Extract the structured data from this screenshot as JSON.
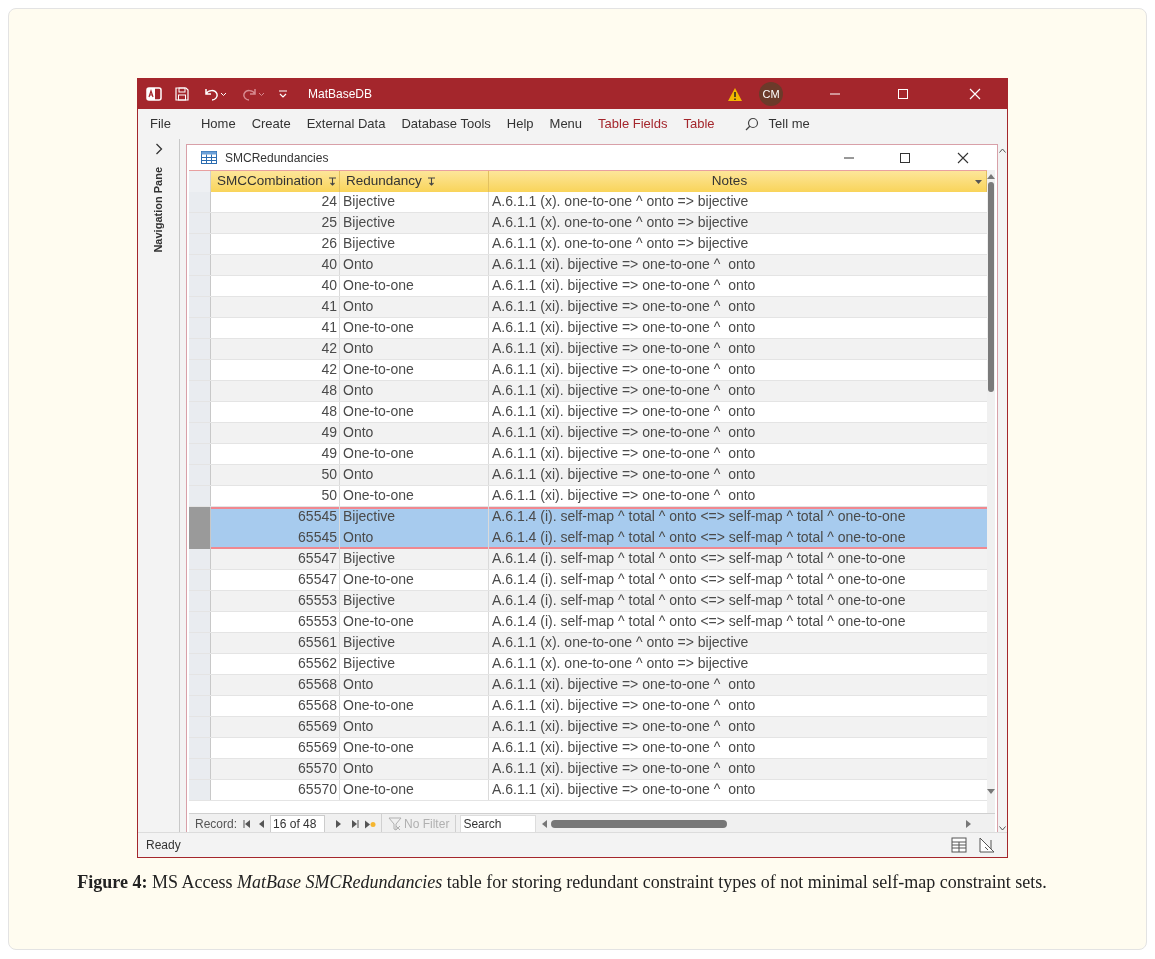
{
  "app": {
    "title": "MatBaseDB",
    "user_initials": "CM"
  },
  "ribbon_tabs": [
    {
      "label": "File",
      "kind": "plain"
    },
    {
      "label": "Home",
      "kind": "plain"
    },
    {
      "label": "Create",
      "kind": "plain"
    },
    {
      "label": "External Data",
      "kind": "plain"
    },
    {
      "label": "Database Tools",
      "kind": "plain"
    },
    {
      "label": "Help",
      "kind": "plain"
    },
    {
      "label": "Menu",
      "kind": "plain"
    },
    {
      "label": "Table Fields",
      "kind": "contextual"
    },
    {
      "label": "Table",
      "kind": "contextual"
    }
  ],
  "tell_me": "Tell me",
  "navigation_pane": {
    "label": "Navigation Pane"
  },
  "document": {
    "title": "SMCRedundancies"
  },
  "table": {
    "columns": [
      {
        "label": "SMCCombination",
        "sorted": true
      },
      {
        "label": "Redundancy",
        "sorted": true
      },
      {
        "label": "Notes",
        "sorted": false
      }
    ],
    "rows": [
      {
        "smc_combination": "24",
        "redundancy": "Bijective",
        "notes": "A.6.1.1 (x). one-to-one ^ onto => bijective",
        "selected": false
      },
      {
        "smc_combination": "25",
        "redundancy": "Bijective",
        "notes": "A.6.1.1 (x). one-to-one ^ onto => bijective",
        "selected": false
      },
      {
        "smc_combination": "26",
        "redundancy": "Bijective",
        "notes": "A.6.1.1 (x). one-to-one ^ onto => bijective",
        "selected": false
      },
      {
        "smc_combination": "40",
        "redundancy": "Onto",
        "notes": "A.6.1.1 (xi). bijective => one-to-one ^  onto",
        "selected": false
      },
      {
        "smc_combination": "40",
        "redundancy": "One-to-one",
        "notes": "A.6.1.1 (xi). bijective => one-to-one ^  onto",
        "selected": false
      },
      {
        "smc_combination": "41",
        "redundancy": "Onto",
        "notes": "A.6.1.1 (xi). bijective => one-to-one ^  onto",
        "selected": false
      },
      {
        "smc_combination": "41",
        "redundancy": "One-to-one",
        "notes": "A.6.1.1 (xi). bijective => one-to-one ^  onto",
        "selected": false
      },
      {
        "smc_combination": "42",
        "redundancy": "Onto",
        "notes": "A.6.1.1 (xi). bijective => one-to-one ^  onto",
        "selected": false
      },
      {
        "smc_combination": "42",
        "redundancy": "One-to-one",
        "notes": "A.6.1.1 (xi). bijective => one-to-one ^  onto",
        "selected": false
      },
      {
        "smc_combination": "48",
        "redundancy": "Onto",
        "notes": "A.6.1.1 (xi). bijective => one-to-one ^  onto",
        "selected": false
      },
      {
        "smc_combination": "48",
        "redundancy": "One-to-one",
        "notes": "A.6.1.1 (xi). bijective => one-to-one ^  onto",
        "selected": false
      },
      {
        "smc_combination": "49",
        "redundancy": "Onto",
        "notes": "A.6.1.1 (xi). bijective => one-to-one ^  onto",
        "selected": false
      },
      {
        "smc_combination": "49",
        "redundancy": "One-to-one",
        "notes": "A.6.1.1 (xi). bijective => one-to-one ^  onto",
        "selected": false
      },
      {
        "smc_combination": "50",
        "redundancy": "Onto",
        "notes": "A.6.1.1 (xi). bijective => one-to-one ^  onto",
        "selected": false
      },
      {
        "smc_combination": "50",
        "redundancy": "One-to-one",
        "notes": "A.6.1.1 (xi). bijective => one-to-one ^  onto",
        "selected": false
      },
      {
        "smc_combination": "65545",
        "redundancy": "Bijective",
        "notes": "A.6.1.4 (i). self-map ^ total ^ onto <=> self-map ^ total ^ one-to-one",
        "selected": true
      },
      {
        "smc_combination": "65545",
        "redundancy": "Onto",
        "notes": "A.6.1.4 (i). self-map ^ total ^ onto <=> self-map ^ total ^ one-to-one",
        "selected": true
      },
      {
        "smc_combination": "65547",
        "redundancy": "Bijective",
        "notes": "A.6.1.4 (i). self-map ^ total ^ onto <=> self-map ^ total ^ one-to-one",
        "selected": false
      },
      {
        "smc_combination": "65547",
        "redundancy": "One-to-one",
        "notes": "A.6.1.4 (i). self-map ^ total ^ onto <=> self-map ^ total ^ one-to-one",
        "selected": false
      },
      {
        "smc_combination": "65553",
        "redundancy": "Bijective",
        "notes": "A.6.1.4 (i). self-map ^ total ^ onto <=> self-map ^ total ^ one-to-one",
        "selected": false
      },
      {
        "smc_combination": "65553",
        "redundancy": "One-to-one",
        "notes": "A.6.1.4 (i). self-map ^ total ^ onto <=> self-map ^ total ^ one-to-one",
        "selected": false
      },
      {
        "smc_combination": "65561",
        "redundancy": "Bijective",
        "notes": "A.6.1.1 (x). one-to-one ^ onto => bijective",
        "selected": false
      },
      {
        "smc_combination": "65562",
        "redundancy": "Bijective",
        "notes": "A.6.1.1 (x). one-to-one ^ onto => bijective",
        "selected": false
      },
      {
        "smc_combination": "65568",
        "redundancy": "Onto",
        "notes": "A.6.1.1 (xi). bijective => one-to-one ^  onto",
        "selected": false
      },
      {
        "smc_combination": "65568",
        "redundancy": "One-to-one",
        "notes": "A.6.1.1 (xi). bijective => one-to-one ^  onto",
        "selected": false
      },
      {
        "smc_combination": "65569",
        "redundancy": "Onto",
        "notes": "A.6.1.1 (xi). bijective => one-to-one ^  onto",
        "selected": false
      },
      {
        "smc_combination": "65569",
        "redundancy": "One-to-one",
        "notes": "A.6.1.1 (xi). bijective => one-to-one ^  onto",
        "selected": false
      },
      {
        "smc_combination": "65570",
        "redundancy": "Onto",
        "notes": "A.6.1.1 (xi). bijective => one-to-one ^  onto",
        "selected": false
      },
      {
        "smc_combination": "65570",
        "redundancy": "One-to-one",
        "notes": "A.6.1.1 (xi). bijective => one-to-one ^  onto",
        "selected": false
      }
    ]
  },
  "record_nav": {
    "label": "Record:",
    "position": "16 of 48",
    "filter": "No Filter",
    "search_placeholder": "Search"
  },
  "status_bar": {
    "text": "Ready"
  },
  "caption": "**Figure 4:** MS Access *MatBase SMCRedundancies* table for storing redundant constraint types of not minimal self-map constraint sets."
}
